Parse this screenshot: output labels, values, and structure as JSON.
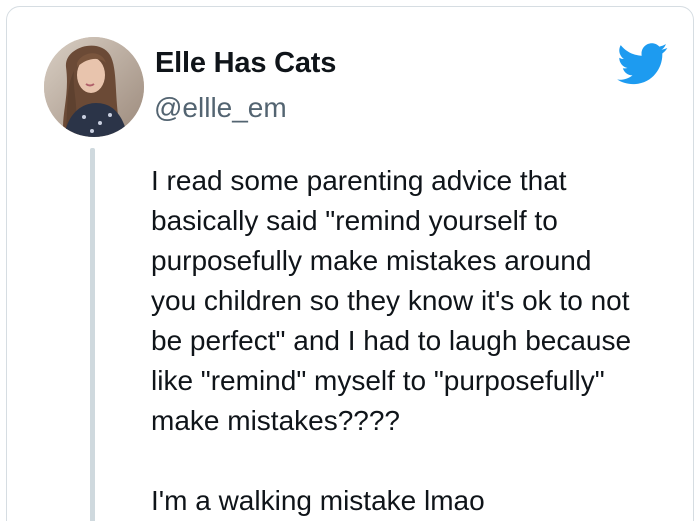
{
  "tweet": {
    "author": {
      "display_name": "Elle Has Cats",
      "handle": "@ellle_em",
      "avatar_icon": "profile-photo"
    },
    "logo_icon": "twitter-bird-icon",
    "brand_color": "#1d9bf0",
    "text_lines": [
      "I read some parenting advice that",
      "basically said \"remind yourself to",
      "purposefully make mistakes around",
      "you children so they know it's ok to not",
      "be perfect\" and I had to laugh because",
      "like \"remind\" myself to \"purposefully\"",
      "make mistakes????"
    ],
    "text_lines_2": [
      "I'm a walking mistake lmao"
    ]
  }
}
